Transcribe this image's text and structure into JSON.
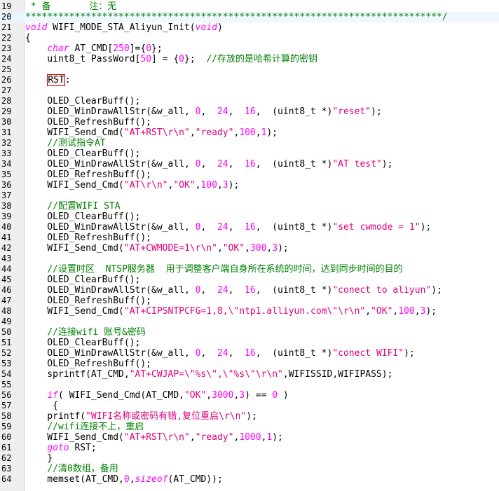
{
  "editor": {
    "lines": [
      {
        "num": "19",
        "tokens": [
          {
            "t": " * 备       注：无",
            "c": "comment"
          }
        ]
      },
      {
        "num": "20",
        "tokens": [
          {
            "t": "****************************************************************************/",
            "c": "comment"
          }
        ]
      },
      {
        "num": "21",
        "tokens": [
          {
            "t": "void",
            "c": "keyword"
          },
          {
            "t": " WIFI_MODE_STA_Aliyun_Init(",
            "c": "plain"
          },
          {
            "t": "void",
            "c": "keyword"
          },
          {
            "t": ")",
            "c": "plain"
          }
        ]
      },
      {
        "num": "22",
        "tokens": [
          {
            "t": "{",
            "c": "plain"
          }
        ]
      },
      {
        "num": "23",
        "tokens": [
          {
            "t": "    ",
            "c": "plain"
          },
          {
            "t": "char",
            "c": "keyword"
          },
          {
            "t": " AT_CMD[",
            "c": "plain"
          },
          {
            "t": "250",
            "c": "number"
          },
          {
            "t": "]={",
            "c": "plain"
          },
          {
            "t": "0",
            "c": "number"
          },
          {
            "t": "};",
            "c": "plain"
          }
        ]
      },
      {
        "num": "24",
        "tokens": [
          {
            "t": "    uint8_t PassWord[",
            "c": "plain"
          },
          {
            "t": "50",
            "c": "number"
          },
          {
            "t": "] = {",
            "c": "plain"
          },
          {
            "t": "0",
            "c": "number"
          },
          {
            "t": "};  ",
            "c": "plain"
          },
          {
            "t": "//存放的是哈希计算的密钥",
            "c": "comment"
          }
        ]
      },
      {
        "num": "25",
        "tokens": []
      },
      {
        "num": "26",
        "tokens": [
          {
            "t": "    ",
            "c": "plain"
          },
          {
            "t": "RST",
            "c": "label"
          },
          {
            "t": ":",
            "c": "plain"
          }
        ]
      },
      {
        "num": "27",
        "tokens": []
      },
      {
        "num": "28",
        "tokens": [
          {
            "t": "    OLED_ClearBuff();",
            "c": "plain"
          }
        ]
      },
      {
        "num": "29",
        "tokens": [
          {
            "t": "    OLED_WinDrawAllStr(&w_all, ",
            "c": "plain"
          },
          {
            "t": "0",
            "c": "number"
          },
          {
            "t": ",  ",
            "c": "plain"
          },
          {
            "t": "24",
            "c": "number"
          },
          {
            "t": ",  ",
            "c": "plain"
          },
          {
            "t": "16",
            "c": "number"
          },
          {
            "t": ",  (uint8_t *)",
            "c": "plain"
          },
          {
            "t": "\"reset\"",
            "c": "string"
          },
          {
            "t": ");",
            "c": "plain"
          }
        ]
      },
      {
        "num": "30",
        "tokens": [
          {
            "t": "    OLED_RefreshBuff();",
            "c": "plain"
          }
        ]
      },
      {
        "num": "31",
        "tokens": [
          {
            "t": "    WIFI_Send_Cmd(",
            "c": "plain"
          },
          {
            "t": "\"AT+RST\\r\\n\"",
            "c": "string"
          },
          {
            "t": ",",
            "c": "plain"
          },
          {
            "t": "\"ready\"",
            "c": "string"
          },
          {
            "t": ",",
            "c": "plain"
          },
          {
            "t": "100",
            "c": "number"
          },
          {
            "t": ",",
            "c": "plain"
          },
          {
            "t": "1",
            "c": "number"
          },
          {
            "t": ");",
            "c": "plain"
          }
        ]
      },
      {
        "num": "32",
        "tokens": [
          {
            "t": "    ",
            "c": "plain"
          },
          {
            "t": "//测试指令AT",
            "c": "comment"
          }
        ]
      },
      {
        "num": "33",
        "tokens": [
          {
            "t": "    OLED_ClearBuff();",
            "c": "plain"
          }
        ]
      },
      {
        "num": "34",
        "tokens": [
          {
            "t": "    OLED_WinDrawAllStr(&w_all, ",
            "c": "plain"
          },
          {
            "t": "0",
            "c": "number"
          },
          {
            "t": ",  ",
            "c": "plain"
          },
          {
            "t": "24",
            "c": "number"
          },
          {
            "t": ",  ",
            "c": "plain"
          },
          {
            "t": "16",
            "c": "number"
          },
          {
            "t": ",  (uint8_t *)",
            "c": "plain"
          },
          {
            "t": "\"AT test\"",
            "c": "string"
          },
          {
            "t": ");",
            "c": "plain"
          }
        ]
      },
      {
        "num": "35",
        "tokens": [
          {
            "t": "    OLED_RefreshBuff();",
            "c": "plain"
          }
        ]
      },
      {
        "num": "36",
        "tokens": [
          {
            "t": "    WIFI_Send_Cmd(",
            "c": "plain"
          },
          {
            "t": "\"AT\\r\\n\"",
            "c": "string"
          },
          {
            "t": ",",
            "c": "plain"
          },
          {
            "t": "\"OK\"",
            "c": "string"
          },
          {
            "t": ",",
            "c": "plain"
          },
          {
            "t": "100",
            "c": "number"
          },
          {
            "t": ",",
            "c": "plain"
          },
          {
            "t": "3",
            "c": "number"
          },
          {
            "t": ");",
            "c": "plain"
          }
        ]
      },
      {
        "num": "37",
        "tokens": []
      },
      {
        "num": "38",
        "tokens": [
          {
            "t": "    ",
            "c": "plain"
          },
          {
            "t": "//配置WIFI STA",
            "c": "comment"
          }
        ]
      },
      {
        "num": "39",
        "tokens": [
          {
            "t": "    OLED_ClearBuff();",
            "c": "plain"
          }
        ]
      },
      {
        "num": "40",
        "tokens": [
          {
            "t": "    OLED_WinDrawAllStr(&w_all, ",
            "c": "plain"
          },
          {
            "t": "0",
            "c": "number"
          },
          {
            "t": ",  ",
            "c": "plain"
          },
          {
            "t": "24",
            "c": "number"
          },
          {
            "t": ",  ",
            "c": "plain"
          },
          {
            "t": "16",
            "c": "number"
          },
          {
            "t": ",  (uint8_t *)",
            "c": "plain"
          },
          {
            "t": "\"set cwmode = 1\"",
            "c": "string"
          },
          {
            "t": ");",
            "c": "plain"
          }
        ]
      },
      {
        "num": "41",
        "tokens": [
          {
            "t": "    OLED_RefreshBuff();",
            "c": "plain"
          }
        ]
      },
      {
        "num": "42",
        "tokens": [
          {
            "t": "    WIFI_Send_Cmd(",
            "c": "plain"
          },
          {
            "t": "\"AT+CWMODE=1\\r\\n\"",
            "c": "string"
          },
          {
            "t": ",",
            "c": "plain"
          },
          {
            "t": "\"OK\"",
            "c": "string"
          },
          {
            "t": ",",
            "c": "plain"
          },
          {
            "t": "300",
            "c": "number"
          },
          {
            "t": ",",
            "c": "plain"
          },
          {
            "t": "3",
            "c": "number"
          },
          {
            "t": ");",
            "c": "plain"
          }
        ]
      },
      {
        "num": "43",
        "tokens": []
      },
      {
        "num": "44",
        "tokens": [
          {
            "t": "    ",
            "c": "plain"
          },
          {
            "t": "//设置时区  NTSP服务器  用于调整客户端自身所在系统的时间，达到同步时间的目的",
            "c": "comment"
          }
        ]
      },
      {
        "num": "45",
        "tokens": [
          {
            "t": "    OLED_ClearBuff();",
            "c": "plain"
          }
        ]
      },
      {
        "num": "46",
        "tokens": [
          {
            "t": "    OLED_WinDrawAllStr(&w_all, ",
            "c": "plain"
          },
          {
            "t": "0",
            "c": "number"
          },
          {
            "t": ",  ",
            "c": "plain"
          },
          {
            "t": "24",
            "c": "number"
          },
          {
            "t": ",  ",
            "c": "plain"
          },
          {
            "t": "16",
            "c": "number"
          },
          {
            "t": ",  (uint8_t *)",
            "c": "plain"
          },
          {
            "t": "\"conect to aliyun\"",
            "c": "string"
          },
          {
            "t": ");",
            "c": "plain"
          }
        ]
      },
      {
        "num": "47",
        "tokens": [
          {
            "t": "    OLED_RefreshBuff();",
            "c": "plain"
          }
        ]
      },
      {
        "num": "48",
        "tokens": [
          {
            "t": "    WIFI_Send_Cmd(",
            "c": "plain"
          },
          {
            "t": "\"AT+CIPSNTPCFG=1,8,\\\"ntp1.alliyun.com\\\"\\r\\n\"",
            "c": "string"
          },
          {
            "t": ",",
            "c": "plain"
          },
          {
            "t": "\"OK\"",
            "c": "string"
          },
          {
            "t": ",",
            "c": "plain"
          },
          {
            "t": "100",
            "c": "number"
          },
          {
            "t": ",",
            "c": "plain"
          },
          {
            "t": "3",
            "c": "number"
          },
          {
            "t": ");",
            "c": "plain"
          }
        ]
      },
      {
        "num": "49",
        "tokens": []
      },
      {
        "num": "50",
        "tokens": [
          {
            "t": "    ",
            "c": "plain"
          },
          {
            "t": "//连接wifi 账号&密码",
            "c": "comment"
          }
        ]
      },
      {
        "num": "51",
        "tokens": [
          {
            "t": "    OLED_ClearBuff();",
            "c": "plain"
          }
        ]
      },
      {
        "num": "52",
        "tokens": [
          {
            "t": "    OLED_WinDrawAllStr(&w_all, ",
            "c": "plain"
          },
          {
            "t": "0",
            "c": "number"
          },
          {
            "t": ",  ",
            "c": "plain"
          },
          {
            "t": "24",
            "c": "number"
          },
          {
            "t": ",  ",
            "c": "plain"
          },
          {
            "t": "16",
            "c": "number"
          },
          {
            "t": ",  (uint8_t *)",
            "c": "plain"
          },
          {
            "t": "\"conect WIFI\"",
            "c": "string"
          },
          {
            "t": ");",
            "c": "plain"
          }
        ]
      },
      {
        "num": "53",
        "tokens": [
          {
            "t": "    OLED_RefreshBuff();",
            "c": "plain"
          }
        ]
      },
      {
        "num": "54",
        "tokens": [
          {
            "t": "    sprintf(AT_CMD,",
            "c": "plain"
          },
          {
            "t": "\"AT+CWJAP=\\\"%s\\\",\\\"%s\\\"\\r\\n\"",
            "c": "string"
          },
          {
            "t": ",WIFISSID,WIFIPASS);",
            "c": "plain"
          }
        ]
      },
      {
        "num": "55",
        "tokens": []
      },
      {
        "num": "56",
        "tokens": [
          {
            "t": "    ",
            "c": "plain"
          },
          {
            "t": "if",
            "c": "keyword"
          },
          {
            "t": "( WIFI_Send_Cmd(AT_CMD,",
            "c": "plain"
          },
          {
            "t": "\"OK\"",
            "c": "string"
          },
          {
            "t": ",",
            "c": "plain"
          },
          {
            "t": "3000",
            "c": "number"
          },
          {
            "t": ",",
            "c": "plain"
          },
          {
            "t": "3",
            "c": "number"
          },
          {
            "t": ") == ",
            "c": "plain"
          },
          {
            "t": "0",
            "c": "number"
          },
          {
            "t": " )",
            "c": "plain"
          }
        ]
      },
      {
        "num": "57",
        "tokens": [
          {
            "t": "     {",
            "c": "plain"
          }
        ]
      },
      {
        "num": "58",
        "tokens": [
          {
            "t": "    printf(",
            "c": "plain"
          },
          {
            "t": "\"WIFI名称或密码有错,复位重启\\r\\n\"",
            "c": "string"
          },
          {
            "t": ");",
            "c": "plain"
          }
        ]
      },
      {
        "num": "59",
        "tokens": [
          {
            "t": "    ",
            "c": "plain"
          },
          {
            "t": "//wifi连接不上，重启",
            "c": "comment"
          }
        ]
      },
      {
        "num": "60",
        "tokens": [
          {
            "t": "    WIFI_Send_Cmd(",
            "c": "plain"
          },
          {
            "t": "\"AT+RST\\r\\n\"",
            "c": "string"
          },
          {
            "t": ",",
            "c": "plain"
          },
          {
            "t": "\"ready\"",
            "c": "string"
          },
          {
            "t": ",",
            "c": "plain"
          },
          {
            "t": "1000",
            "c": "number"
          },
          {
            "t": ",",
            "c": "plain"
          },
          {
            "t": "1",
            "c": "number"
          },
          {
            "t": ");",
            "c": "plain"
          }
        ]
      },
      {
        "num": "61",
        "tokens": [
          {
            "t": "    ",
            "c": "plain"
          },
          {
            "t": "goto",
            "c": "keyword"
          },
          {
            "t": " RST;",
            "c": "plain"
          }
        ]
      },
      {
        "num": "62",
        "tokens": [
          {
            "t": "    }",
            "c": "plain"
          }
        ]
      },
      {
        "num": "63",
        "tokens": [
          {
            "t": "    ",
            "c": "plain"
          },
          {
            "t": "//清0数组，备用",
            "c": "comment"
          }
        ]
      },
      {
        "num": "64",
        "tokens": [
          {
            "t": "    memset(AT_CMD,",
            "c": "plain"
          },
          {
            "t": "0",
            "c": "number"
          },
          {
            "t": ",",
            "c": "plain"
          },
          {
            "t": "sizeof",
            "c": "keyword"
          },
          {
            "t": "(AT_CMD));",
            "c": "plain"
          }
        ]
      }
    ]
  },
  "colors": {
    "comment": "#008000",
    "keyword": "#ff00ff",
    "number": "#ff00ff",
    "string": "#e00080",
    "plain": "#000000",
    "gutter_bg": "#efefef",
    "current_line_bg": "#eaf6ff"
  }
}
